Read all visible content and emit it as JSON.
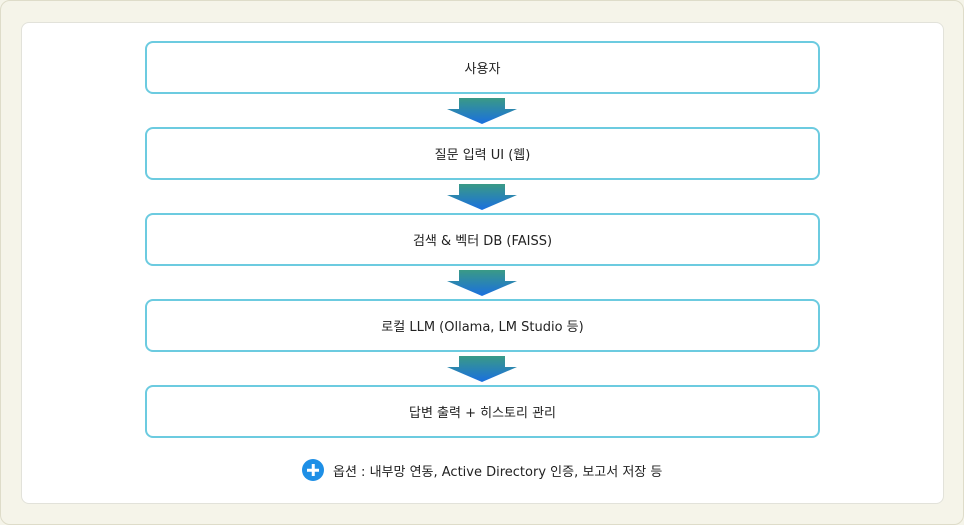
{
  "steps": [
    "사용자",
    "질문 입력 UI (웹)",
    "검색 & 벡터 DB (FAISS)",
    "로컬 LLM (Ollama, LM Studio 등)",
    "답변 출력 + 히스토리 관리"
  ],
  "option": {
    "icon": "plus-icon",
    "text": "옵션 : 내부망 연동, Active Directory 인증, 보고서 저장 등"
  },
  "colors": {
    "box_border": "#6ccbe0",
    "arrow_top": "#3a9a86",
    "arrow_bottom": "#1a6fe0",
    "plus_icon": "#1e8fe6",
    "background": "#f5f4e9"
  }
}
